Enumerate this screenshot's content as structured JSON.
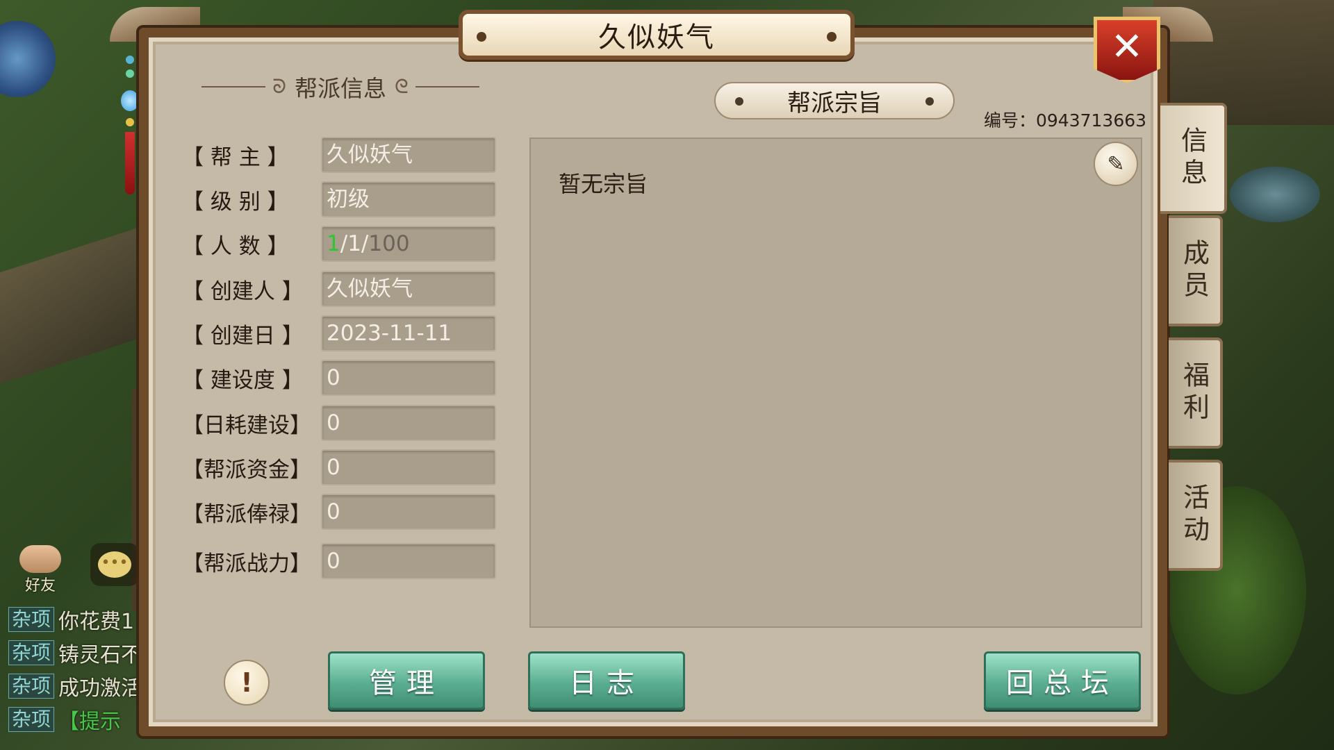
{
  "window": {
    "title": "久似妖气",
    "close_label": "✕"
  },
  "section": {
    "title": "帮派信息"
  },
  "fields": [
    {
      "label": "【 帮  主 】",
      "value": "久似妖气"
    },
    {
      "label": "【 级  别 】",
      "value": "初级"
    },
    {
      "label": "【 人  数 】",
      "value_online": "1",
      "value_current": "1",
      "value_max": "100",
      "sep": "/"
    },
    {
      "label": "【 创建人 】",
      "value": "久似妖气"
    },
    {
      "label": "【 创建日 】",
      "value": "2023-11-11"
    },
    {
      "label": "【 建设度 】",
      "value": "0"
    },
    {
      "label": "【日耗建设】",
      "value": "0"
    },
    {
      "label": "【帮派资金】",
      "value": "0"
    },
    {
      "label": "【帮派俸禄】",
      "value": "0"
    },
    {
      "label": "【帮派战力】",
      "value": "0"
    }
  ],
  "purpose": {
    "title": "帮派宗旨",
    "serial": "编号：0943713663",
    "text": "暂无宗旨"
  },
  "tabs": [
    {
      "label": "信息",
      "active": true
    },
    {
      "label": "成员",
      "active": false
    },
    {
      "label": "福利",
      "active": false
    },
    {
      "label": "活动",
      "active": false
    }
  ],
  "buttons": {
    "info": "!",
    "manage": "管理",
    "log": "日志",
    "back": "回总坛"
  },
  "hud": {
    "friend_label": "好友",
    "chat_lines": [
      {
        "tag": "杂项",
        "text": "你花费1"
      },
      {
        "tag": "杂项",
        "text": "铸灵石不"
      },
      {
        "tag": "杂项",
        "text": "成功激活"
      },
      {
        "tag": "杂项",
        "text": "【提示"
      }
    ]
  },
  "colors": {
    "online_count": "#2ec62e",
    "button_green": "#5cae92",
    "close_red": "#c02a1a"
  }
}
